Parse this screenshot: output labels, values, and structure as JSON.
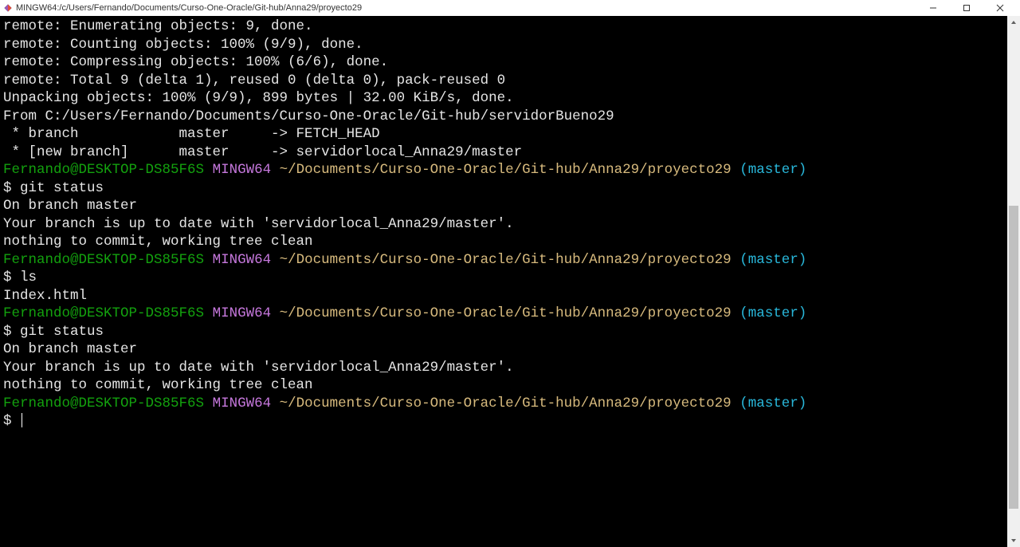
{
  "window": {
    "title": "MINGW64:/c/Users/Fernando/Documents/Curso-One-Oracle/Git-hub/Anna29/proyecto29"
  },
  "terminal": {
    "lines": [
      {
        "segments": [
          {
            "text": "remote: Enumerating objects: 9, done.",
            "cls": "white"
          }
        ]
      },
      {
        "segments": [
          {
            "text": "remote: Counting objects: 100% (9/9), done.",
            "cls": "white"
          }
        ]
      },
      {
        "segments": [
          {
            "text": "remote: Compressing objects: 100% (6/6), done.",
            "cls": "white"
          }
        ]
      },
      {
        "segments": [
          {
            "text": "remote: Total 9 (delta 1), reused 0 (delta 0), pack-reused 0",
            "cls": "white"
          }
        ]
      },
      {
        "segments": [
          {
            "text": "Unpacking objects: 100% (9/9), 899 bytes | 32.00 KiB/s, done.",
            "cls": "white"
          }
        ]
      },
      {
        "segments": [
          {
            "text": "From C:/Users/Fernando/Documents/Curso-One-Oracle/Git-hub/servidorBueno29",
            "cls": "white"
          }
        ]
      },
      {
        "segments": [
          {
            "text": " * branch            master     -> FETCH_HEAD",
            "cls": "white"
          }
        ]
      },
      {
        "segments": [
          {
            "text": " * [new branch]      master     -> servidorlocal_Anna29/master",
            "cls": "white"
          }
        ]
      },
      {
        "segments": [
          {
            "text": "",
            "cls": "white"
          }
        ]
      },
      {
        "segments": [
          {
            "text": "Fernando@DESKTOP-DS85F6S",
            "cls": "green"
          },
          {
            "text": " ",
            "cls": "white"
          },
          {
            "text": "MINGW64",
            "cls": "purple"
          },
          {
            "text": " ",
            "cls": "white"
          },
          {
            "text": "~/Documents/Curso-One-Oracle/Git-hub/Anna29/proyecto29",
            "cls": "yellow"
          },
          {
            "text": " ",
            "cls": "white"
          },
          {
            "text": "(master)",
            "cls": "cyan"
          }
        ]
      },
      {
        "segments": [
          {
            "text": "$ git status",
            "cls": "white"
          }
        ]
      },
      {
        "segments": [
          {
            "text": "On branch master",
            "cls": "white"
          }
        ]
      },
      {
        "segments": [
          {
            "text": "Your branch is up to date with 'servidorlocal_Anna29/master'.",
            "cls": "white"
          }
        ]
      },
      {
        "segments": [
          {
            "text": "",
            "cls": "white"
          }
        ]
      },
      {
        "segments": [
          {
            "text": "nothing to commit, working tree clean",
            "cls": "white"
          }
        ]
      },
      {
        "segments": [
          {
            "text": "",
            "cls": "white"
          }
        ]
      },
      {
        "segments": [
          {
            "text": "Fernando@DESKTOP-DS85F6S",
            "cls": "green"
          },
          {
            "text": " ",
            "cls": "white"
          },
          {
            "text": "MINGW64",
            "cls": "purple"
          },
          {
            "text": " ",
            "cls": "white"
          },
          {
            "text": "~/Documents/Curso-One-Oracle/Git-hub/Anna29/proyecto29",
            "cls": "yellow"
          },
          {
            "text": " ",
            "cls": "white"
          },
          {
            "text": "(master)",
            "cls": "cyan"
          }
        ]
      },
      {
        "segments": [
          {
            "text": "$ ls",
            "cls": "white"
          }
        ]
      },
      {
        "segments": [
          {
            "text": "Index.html",
            "cls": "white"
          }
        ]
      },
      {
        "segments": [
          {
            "text": "",
            "cls": "white"
          }
        ]
      },
      {
        "segments": [
          {
            "text": "Fernando@DESKTOP-DS85F6S",
            "cls": "green"
          },
          {
            "text": " ",
            "cls": "white"
          },
          {
            "text": "MINGW64",
            "cls": "purple"
          },
          {
            "text": " ",
            "cls": "white"
          },
          {
            "text": "~/Documents/Curso-One-Oracle/Git-hub/Anna29/proyecto29",
            "cls": "yellow"
          },
          {
            "text": " ",
            "cls": "white"
          },
          {
            "text": "(master)",
            "cls": "cyan"
          }
        ]
      },
      {
        "segments": [
          {
            "text": "$ git status",
            "cls": "white"
          }
        ]
      },
      {
        "segments": [
          {
            "text": "On branch master",
            "cls": "white"
          }
        ]
      },
      {
        "segments": [
          {
            "text": "Your branch is up to date with 'servidorlocal_Anna29/master'.",
            "cls": "white"
          }
        ]
      },
      {
        "segments": [
          {
            "text": "",
            "cls": "white"
          }
        ]
      },
      {
        "segments": [
          {
            "text": "nothing to commit, working tree clean",
            "cls": "white"
          }
        ]
      },
      {
        "segments": [
          {
            "text": "",
            "cls": "white"
          }
        ]
      },
      {
        "segments": [
          {
            "text": "Fernando@DESKTOP-DS85F6S",
            "cls": "green"
          },
          {
            "text": " ",
            "cls": "white"
          },
          {
            "text": "MINGW64",
            "cls": "purple"
          },
          {
            "text": " ",
            "cls": "white"
          },
          {
            "text": "~/Documents/Curso-One-Oracle/Git-hub/Anna29/proyecto29",
            "cls": "yellow"
          },
          {
            "text": " ",
            "cls": "white"
          },
          {
            "text": "(master)",
            "cls": "cyan"
          }
        ]
      },
      {
        "segments": [
          {
            "text": "$ ",
            "cls": "white"
          }
        ],
        "cursor": true
      }
    ]
  }
}
